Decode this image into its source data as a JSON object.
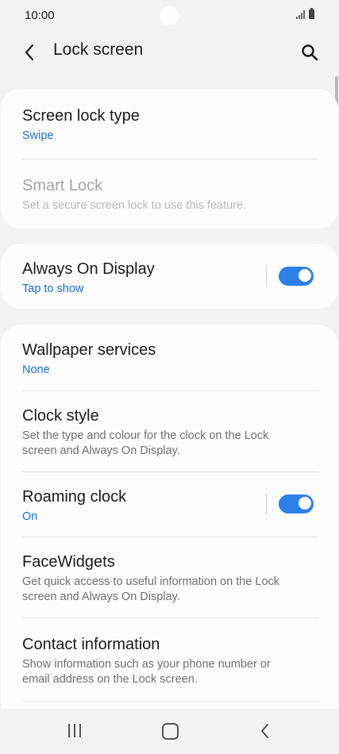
{
  "status_bar": {
    "time": "10:00"
  },
  "header": {
    "title": "Lock screen"
  },
  "card_lock": {
    "screen_lock_type": {
      "title": "Screen lock type",
      "value": "Swipe"
    },
    "smart_lock": {
      "title": "Smart Lock",
      "description": "Set a secure screen lock to use this feature."
    }
  },
  "card_aod": {
    "always_on_display": {
      "title": "Always On Display",
      "value": "Tap to show",
      "toggle_on": true
    }
  },
  "card_more": {
    "wallpaper_services": {
      "title": "Wallpaper services",
      "value": "None"
    },
    "clock_style": {
      "title": "Clock style",
      "description_line1": "Set the type and colour for the clock on the Lock",
      "description_line2": "screen and Always On Display."
    },
    "roaming_clock": {
      "title": "Roaming clock",
      "value": "On",
      "toggle_on": true
    },
    "facewidgets": {
      "title": "FaceWidgets",
      "description_line1": "Get quick access to useful information on the Lock",
      "description_line2": "screen and Always On Display."
    },
    "contact_information": {
      "title": "Contact information",
      "description_line1": "Show information such as your phone number or",
      "description_line2": "email address on the Lock screen."
    }
  },
  "colors": {
    "accent": "#2e80e8",
    "link": "#1a6fc9",
    "background": "#f2f2f2",
    "card": "#fcfcfc"
  },
  "icons": {
    "back": "chevron-left-icon",
    "search": "search-icon",
    "nav_recents": "recents-icon",
    "nav_home": "home-icon",
    "nav_back": "back-icon"
  }
}
